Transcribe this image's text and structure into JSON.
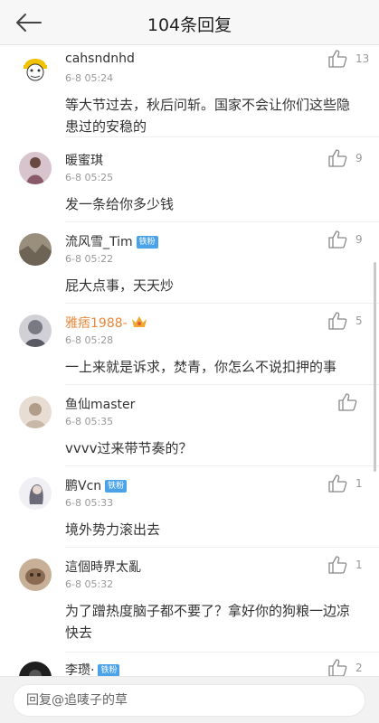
{
  "header": {
    "title": "104条回复",
    "back_icon": "back-arrow-icon"
  },
  "comments": [
    {
      "username": "cahsndnhd",
      "time": "6-8 05:24",
      "text": "等大节过去，秋后问斩。国家不会让你们这些隐患过的安稳的",
      "likes": "13",
      "badge": "",
      "avatar_color": "#f2c200"
    },
    {
      "username": "暖蜜琪",
      "time": "6-8 05:25",
      "text": "发一条给你多少钱",
      "likes": "9",
      "badge": "",
      "avatar_color": "#b07a8a"
    },
    {
      "username": "流风雪_Tim",
      "time": "6-8 05:22",
      "text": "屁大点事，天天炒",
      "likes": "9",
      "badge": "铁粉",
      "avatar_color": "#8a8070"
    },
    {
      "username": "雅痞1988-",
      "time": "6-8 05:28",
      "text": "一上来就是诉求，焚青，你怎么不说扣押的事",
      "likes": "5",
      "badge": "",
      "avatar_color": "#a0a0a8",
      "vip": true
    },
    {
      "username": "鱼仙master",
      "time": "6-8 05:35",
      "text": "vvvv过来带节奏的？",
      "likes": "",
      "badge": "",
      "avatar_color": "#c8b8a8"
    },
    {
      "username": "鹏Vcn",
      "time": "6-8 05:33",
      "text": "境外势力滚出去",
      "likes": "1",
      "badge": "铁粉",
      "avatar_color": "#9a9aa8"
    },
    {
      "username": "這個時界太亂",
      "time": "6-8 05:32",
      "text": "为了蹭热度脑子都不要了？拿好你的狗粮一边凉快去",
      "likes": "1",
      "badge": "",
      "avatar_color": "#8a6a50"
    },
    {
      "username": "李瓒·",
      "time": "",
      "text": "",
      "likes": "2",
      "badge": "铁粉",
      "avatar_color": "#222222"
    }
  ],
  "footer": {
    "reply_placeholder": "回复@追唛子的草"
  },
  "colors": {
    "accent_badge": "#4aa3e8",
    "vip_name": "#e8873a"
  }
}
